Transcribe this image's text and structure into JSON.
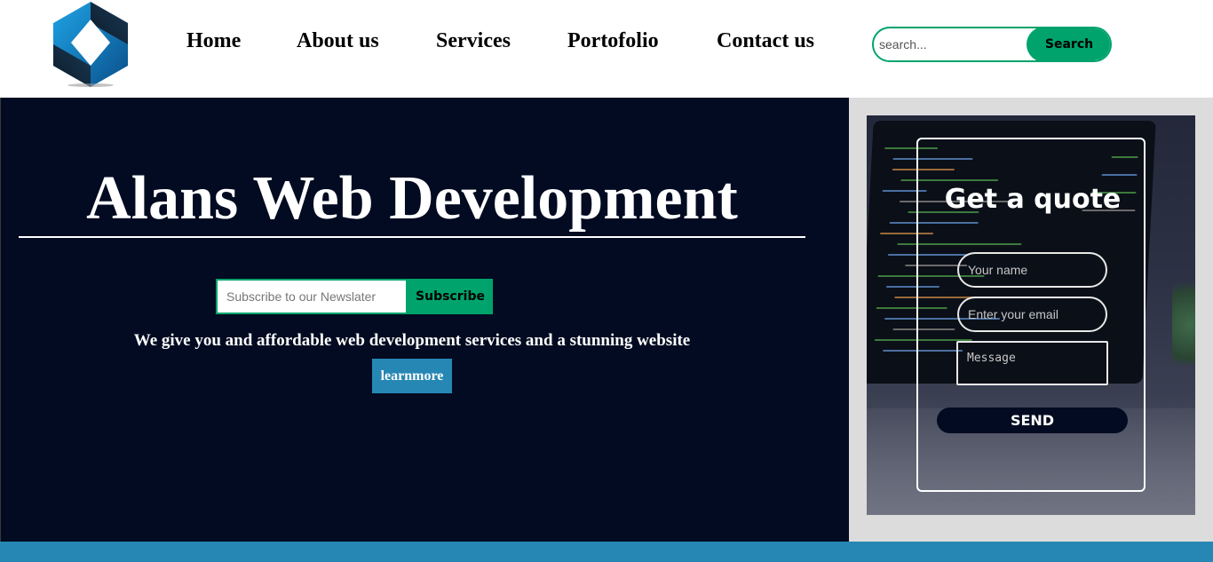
{
  "header": {
    "logo_icon": "diamond-cube-logo-icon",
    "nav": [
      {
        "label": "Home"
      },
      {
        "label": "About us"
      },
      {
        "label": "Services"
      },
      {
        "label": "Portofolio"
      },
      {
        "label": "Contact us"
      }
    ],
    "search": {
      "placeholder": "search...",
      "value": "",
      "button_label": "Search"
    }
  },
  "hero": {
    "title": "Alans Web Development",
    "newsletter": {
      "placeholder": "Subscribe to our Newslater",
      "value": "",
      "button_label": "Subscribe"
    },
    "tagline": "We give you and affordable web development services and a stunning website",
    "learn_more_label": "learnmore"
  },
  "quote": {
    "title": "Get a quote",
    "name_placeholder": "Your name",
    "email_placeholder": "Enter your email",
    "message_placeholder": "Message",
    "send_label": "SEND"
  },
  "colors": {
    "accent_green": "#00a36c",
    "hero_bg": "#020b21",
    "accent_blue": "#2787b4",
    "side_bg": "#dcdcdc"
  }
}
